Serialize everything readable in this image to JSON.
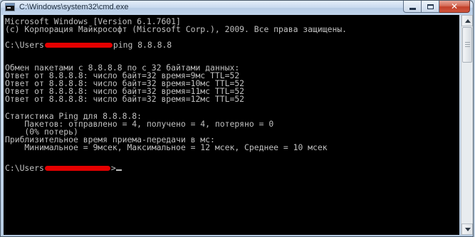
{
  "window": {
    "title": "C:\\Windows\\system32\\cmd.exe",
    "buttons": {
      "minimize": "minimize",
      "maximize": "maximize",
      "close": "✕"
    }
  },
  "console": {
    "lines": [
      "Microsoft Windows [Version 6.1.7601]",
      "(c) Корпорация Майкрософт (Microsoft Corp.), 2009. Все права защищены.",
      "",
      "C:\\Users",
      "ping 8.8.8.8",
      "",
      "Обмен пакетами с 8.8.8.8 по с 32 байтами данных:",
      "Ответ от 8.8.8.8: число байт=32 время=9мс TTL=52",
      "Ответ от 8.8.8.8: число байт=32 время=10мс TTL=52",
      "Ответ от 8.8.8.8: число байт=32 время=11мс TTL=52",
      "Ответ от 8.8.8.8: число байт=32 время=12мс TTL=52",
      "",
      "Статистика Ping для 8.8.8.8:",
      "    Пакетов: отправлено = 4, получено = 4, потеряно = 0",
      "    (0% потерь)",
      "Приблизительное время приема-передачи в мс:",
      "    Минимальное = 9мсек, Максимальное = 12 мсек, Среднее = 10 мсек",
      "",
      "C:\\Users",
      ">"
    ]
  },
  "colors": {
    "console_bg": "#000000",
    "console_fg": "#c0c0c0",
    "redaction": "#e50000"
  },
  "icons": {
    "app": "cmd-icon",
    "scroll_up": "arrow-up-icon",
    "scroll_down": "arrow-down-icon"
  }
}
